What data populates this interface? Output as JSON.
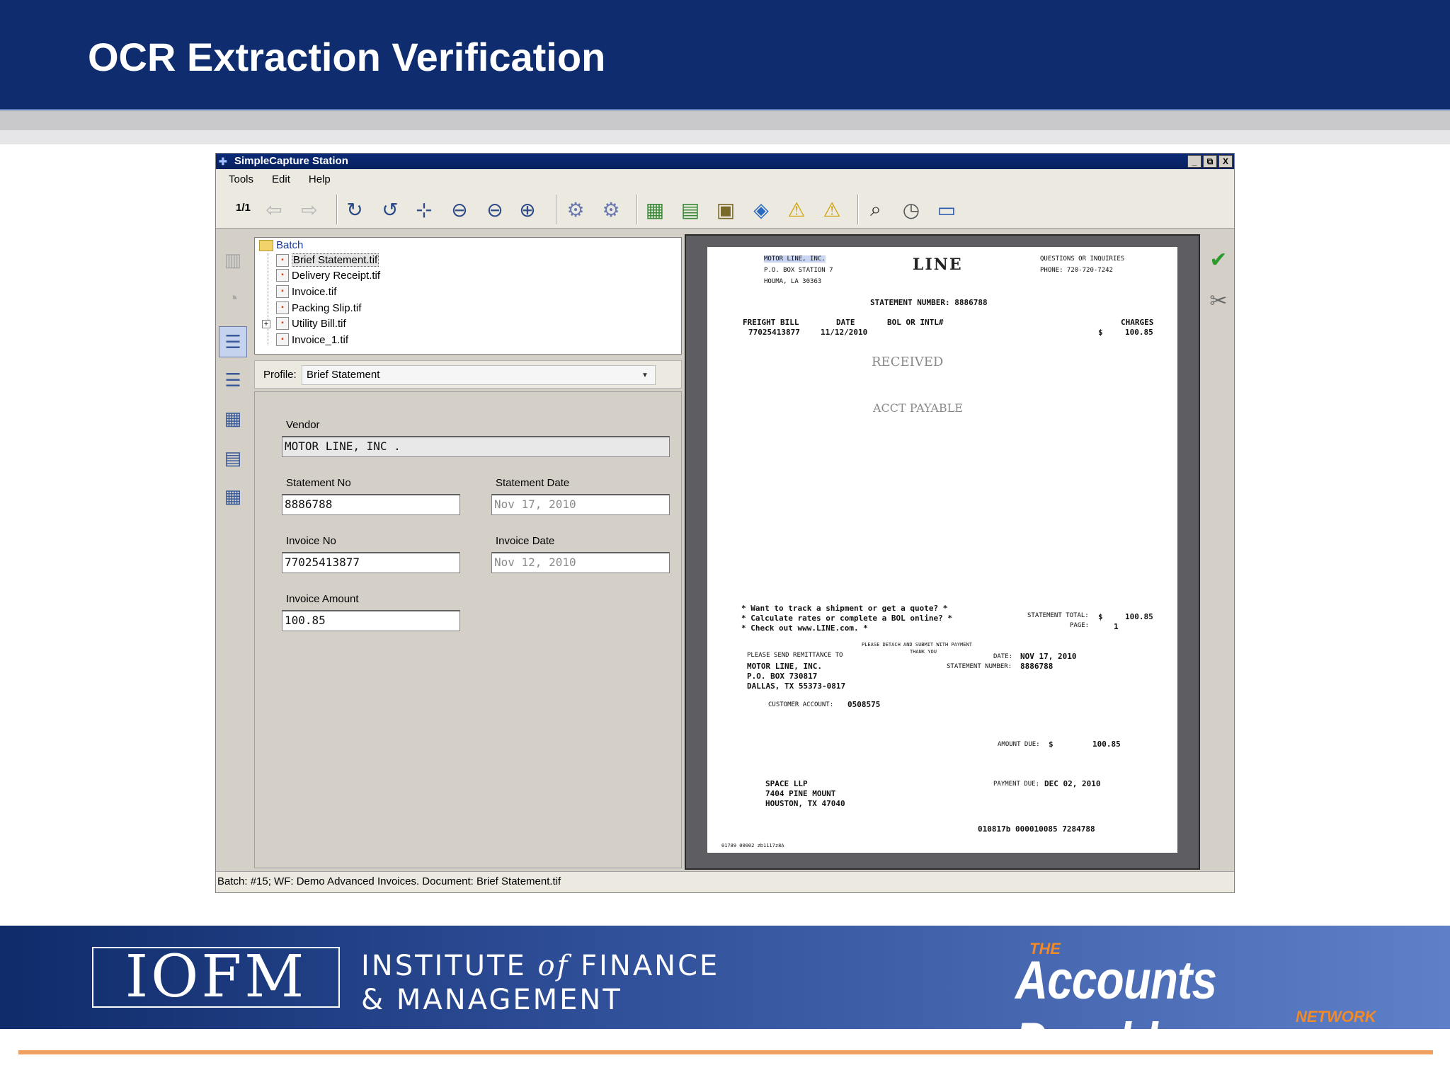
{
  "slide": {
    "title": "OCR Extraction Verification"
  },
  "window": {
    "title": "SimpleCapture Station",
    "controls": [
      "_",
      "⧉",
      "X"
    ],
    "menu": [
      "Tools",
      "Edit",
      "Help"
    ],
    "page_counter": "1/1"
  },
  "toolbar_icons": [
    "prev-page-icon",
    "next-page-icon",
    "rotate-cw-icon",
    "rotate-ccw-icon",
    "fit-page-icon",
    "fit-width-icon",
    "zoom-out-icon",
    "zoom-in-icon",
    "scan-settings-icon",
    "scan-batch-icon",
    "workflow-icon",
    "split-icon",
    "view-doc-icon",
    "review-icon",
    "warning-icon",
    "warning-alt-icon",
    "find-icon",
    "history-icon",
    "save-icon"
  ],
  "tree": {
    "root": "Batch",
    "items": [
      {
        "label": "Brief Statement.tif",
        "selected": true
      },
      {
        "label": "Delivery Receipt.tif"
      },
      {
        "label": "Invoice.tif"
      },
      {
        "label": "Packing Slip.tif"
      },
      {
        "label": "Utility Bill.tif",
        "expandable": true
      },
      {
        "label": "Invoice_1.tif"
      }
    ]
  },
  "profile": {
    "label": "Profile:",
    "value": "Brief Statement"
  },
  "form": {
    "vendor_label": "Vendor",
    "vendor_value": "MOTOR LINE, INC .",
    "statement_no_label": "Statement No",
    "statement_no_value": "8886788",
    "statement_date_label": "Statement Date",
    "statement_date_value": "Nov 17, 2010",
    "invoice_no_label": "Invoice No",
    "invoice_no_value": "77025413877",
    "invoice_date_label": "Invoice Date",
    "invoice_date_value": "Nov 12, 2010",
    "invoice_amount_label": "Invoice Amount",
    "invoice_amount_value": "100.85"
  },
  "document": {
    "vendor_name": "MOTOR LINE, INC.",
    "po_box": "P.O. BOX STATION 7",
    "city": "HOUMA, LA 30363",
    "logo": "LINE",
    "questions": "QUESTIONS OR INQUIRIES",
    "phone": "PHONE: 720-720-7242",
    "statement_number": "STATEMENT NUMBER: 8886788",
    "col_freight": "FREIGHT BILL",
    "col_date": "DATE",
    "col_bol": "BOL OR INTL#",
    "col_charges": "CHARGES",
    "freight_bill": "77025413877",
    "freight_date": "11/12/2010",
    "dollar": "$",
    "charge": "100.85",
    "stamp_received": "RECEIVED",
    "stamp_acct": "ACCT PAYABLE",
    "promo1": "* Want to track a shipment or get a quote?    *",
    "promo2": "* Calculate rates or complete a BOL online?   *",
    "promo3": "*        Check out www.LINE.com.              *",
    "stmt_total_label": "STATEMENT TOTAL:",
    "stmt_total_value": "100.85",
    "page_label": "PAGE:",
    "page_value": "1",
    "detach1": "PLEASE DETACH AND SUBMIT WITH PAYMENT",
    "detach2": "THANK YOU",
    "remit_label": "PLEASE SEND REMITTANCE TO",
    "remit_name": "MOTOR LINE, INC.",
    "remit_po": "P.O. BOX 730817",
    "remit_city": "DALLAS, TX 55373-0817",
    "date_label": "DATE:",
    "date_value": "NOV 17, 2010",
    "stmt_num_label": "STATEMENT NUMBER:",
    "stmt_num_value": "8886788",
    "cust_acct_label": "CUSTOMER ACCOUNT:",
    "cust_acct_value": "0508575",
    "amount_due_label": "AMOUNT DUE:",
    "amount_due_value": "100.85",
    "payment_due_label": "PAYMENT DUE:",
    "payment_due_value": "DEC 02, 2010",
    "cust_name": "SPACE LLP",
    "cust_addr": "7404 PINE MOUNT",
    "cust_city": "HOUSTON, TX 47040",
    "micr": "010817b 000010085 7284788",
    "footer_code": "01789 00002 zb1117z8A"
  },
  "status": {
    "text": "Batch: #15; WF: Demo Advanced Invoices.  Document: Brief Statement.tif"
  },
  "footer": {
    "iofm": "IOFM",
    "inst_line1_a": "INSTITUTE ",
    "inst_line1_of": "of",
    "inst_line1_b": " FINANCE",
    "inst_line2": "& MANAGEMENT",
    "ap_the": "THE",
    "ap_main": "Accounts Payable",
    "ap_network": "NETWORK"
  }
}
